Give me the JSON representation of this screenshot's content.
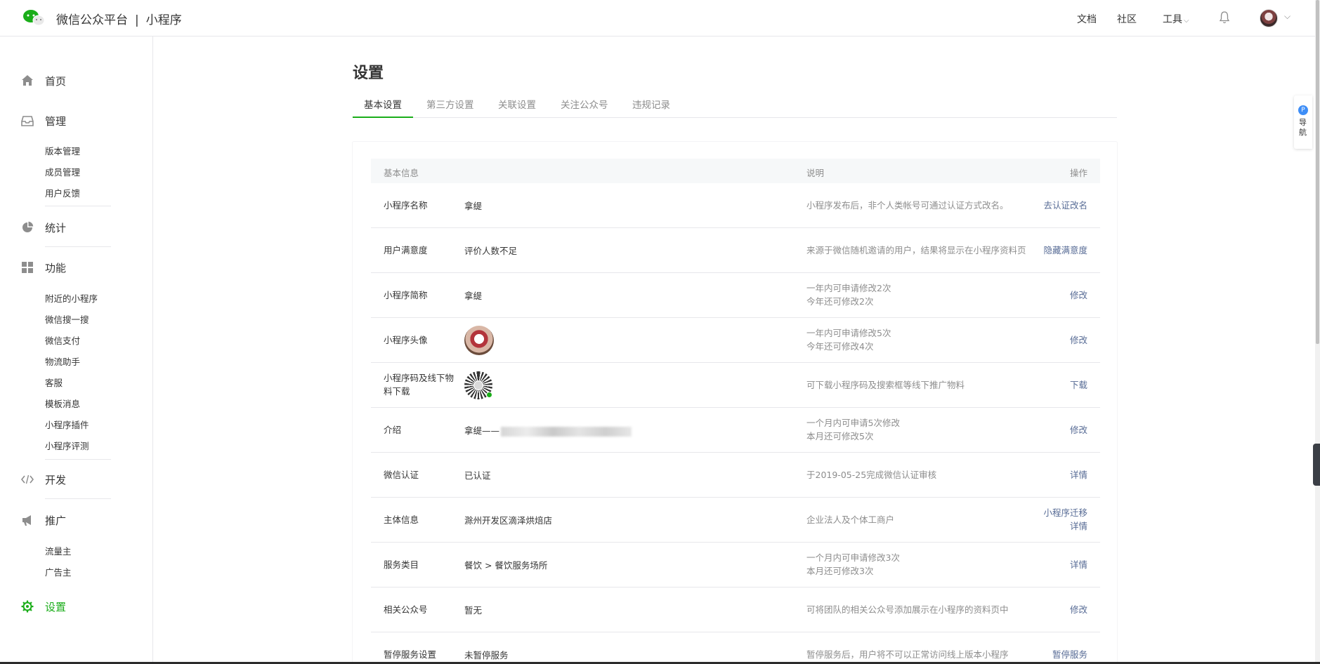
{
  "header": {
    "brand": "微信公众平台",
    "separator": "|",
    "product": "小程序",
    "nav": [
      "文档",
      "社区",
      "工具"
    ]
  },
  "sidebar": {
    "home": "首页",
    "manage": "管理",
    "manage_items": [
      "版本管理",
      "成员管理",
      "用户反馈"
    ],
    "stats": "统计",
    "features": "功能",
    "feature_items": [
      "附近的小程序",
      "微信搜一搜",
      "微信支付",
      "物流助手",
      "客服",
      "模板消息",
      "小程序插件",
      "小程序评测"
    ],
    "dev": "开发",
    "promote": "推广",
    "promote_items": [
      "流量主",
      "广告主"
    ],
    "settings": "设置"
  },
  "main": {
    "title": "设置",
    "tabs": [
      "基本设置",
      "第三方设置",
      "关联设置",
      "关注公众号",
      "违规记录"
    ],
    "table_headers": {
      "info": "基本信息",
      "desc": "说明",
      "op": "操作"
    },
    "rows": [
      {
        "label": "小程序名称",
        "value": "拿缇",
        "desc": [
          "小程序发布后，非个人类帐号可通过认证方式改名。"
        ],
        "ops": [
          "去认证改名"
        ]
      },
      {
        "label": "用户满意度",
        "value": "评价人数不足",
        "desc": [
          "来源于微信随机邀请的用户，结果将显示在小程序资料页"
        ],
        "ops": [
          "隐藏满意度"
        ]
      },
      {
        "label": "小程序简称",
        "value": "拿缇",
        "desc": [
          "一年内可申请修改2次",
          "今年还可修改2次"
        ],
        "ops": [
          "修改"
        ]
      },
      {
        "label": "小程序头像",
        "value": "",
        "desc": [
          "一年内可申请修改5次",
          "今年还可修改4次"
        ],
        "ops": [
          "修改"
        ]
      },
      {
        "label": "小程序码及线下物料下载",
        "value": "",
        "desc": [
          "可下载小程序码及搜索框等线下推广物料"
        ],
        "ops": [
          "下载"
        ]
      },
      {
        "label": "介绍",
        "value": "拿缇——",
        "desc": [
          "一个月内可申请5次修改",
          "本月还可修改5次"
        ],
        "ops": [
          "修改"
        ]
      },
      {
        "label": "微信认证",
        "value": "已认证",
        "desc": [
          "于2019-05-25完成微信认证审核"
        ],
        "ops": [
          "详情"
        ]
      },
      {
        "label": "主体信息",
        "value": "滁州开发区滴泽烘焙店",
        "desc": [
          "企业法人及个体工商户"
        ],
        "ops": [
          "小程序迁移",
          "详情"
        ]
      },
      {
        "label": "服务类目",
        "value": "餐饮 > 餐饮服务场所",
        "desc": [
          "一个月内可申请修改3次",
          "本月还可修改3次"
        ],
        "ops": [
          "详情"
        ]
      },
      {
        "label": "相关公众号",
        "value": "暂无",
        "desc": [
          "可将团队的相关公众号添加展示在小程序的资料页中"
        ],
        "ops": [
          "修改"
        ]
      },
      {
        "label": "暂停服务设置",
        "value": "未暂停服务",
        "desc": [
          "暂停服务后，用户将不可以正常访问线上版本小程序"
        ],
        "ops": [
          "暂停服务"
        ]
      }
    ]
  },
  "float_nav": {
    "badge": "P",
    "label": "导航"
  },
  "colors": {
    "accent": "#1aad19",
    "link": "#576b95",
    "muted": "#8d8d8d"
  }
}
